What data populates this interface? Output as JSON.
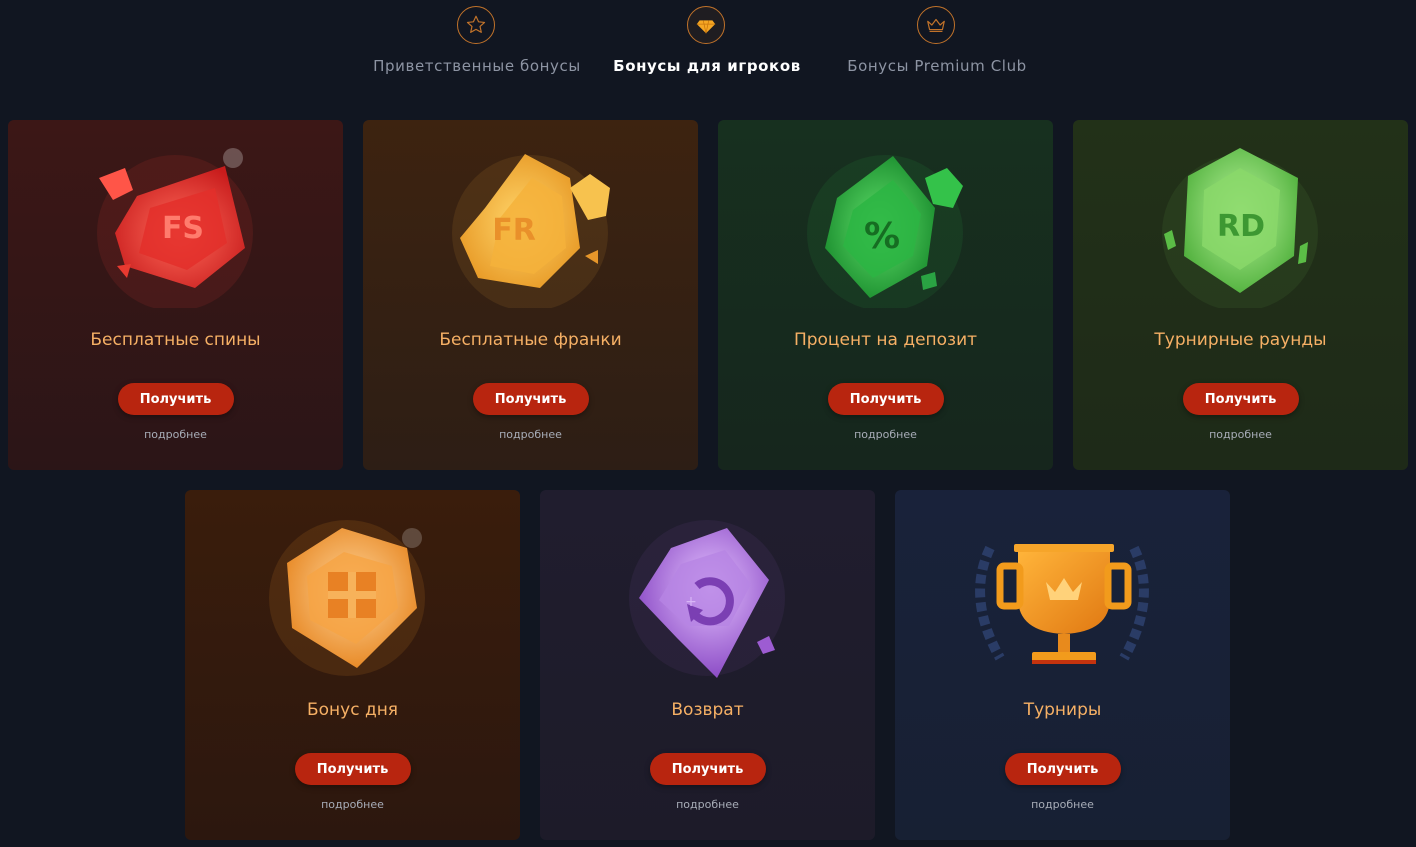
{
  "tabs": [
    {
      "label": "Приветственные бонусы",
      "icon": "star-icon"
    },
    {
      "label": "Бонусы для игроков",
      "icon": "diamond-icon"
    },
    {
      "label": "Бонусы Premium Club",
      "icon": "crown-icon"
    }
  ],
  "active_tab": "Бонусы для игроков",
  "cards": [
    {
      "title": "Бесплатные спины",
      "gem_text": "FS",
      "button": "Получить",
      "more": "подробнее",
      "icon": "red-gem-icon",
      "accent": "#e8392f"
    },
    {
      "title": "Бесплатные франки",
      "gem_text": "FR",
      "button": "Получить",
      "more": "подробнее",
      "icon": "gold-gem-icon",
      "accent": "#f3b53b"
    },
    {
      "title": "Процент на депозит",
      "gem_text": "%",
      "button": "Получить",
      "more": "подробнее",
      "icon": "emerald-gem-icon",
      "accent": "#2fb84a"
    },
    {
      "title": "Турнирные раунды",
      "gem_text": "RD",
      "button": "Получить",
      "more": "подробнее",
      "icon": "green-gem-icon",
      "accent": "#7ed858"
    },
    {
      "title": "Бонус дня",
      "gem_text": "",
      "button": "Получить",
      "more": "подробнее",
      "icon": "orange-gem-gift-icon",
      "accent": "#f39a2a"
    },
    {
      "title": "Возврат",
      "gem_text": "",
      "button": "Получить",
      "more": "подробнее",
      "icon": "purple-gem-refresh-icon",
      "accent": "#a56ad8"
    },
    {
      "title": "Турниры",
      "gem_text": "",
      "button": "Получить",
      "more": "подробнее",
      "icon": "trophy-icon",
      "accent": "#f29b1c"
    }
  ],
  "colors": {
    "background": "#111621",
    "button": "#b8250f",
    "title": "#f6b065",
    "tab_ring": "#c0722a"
  }
}
